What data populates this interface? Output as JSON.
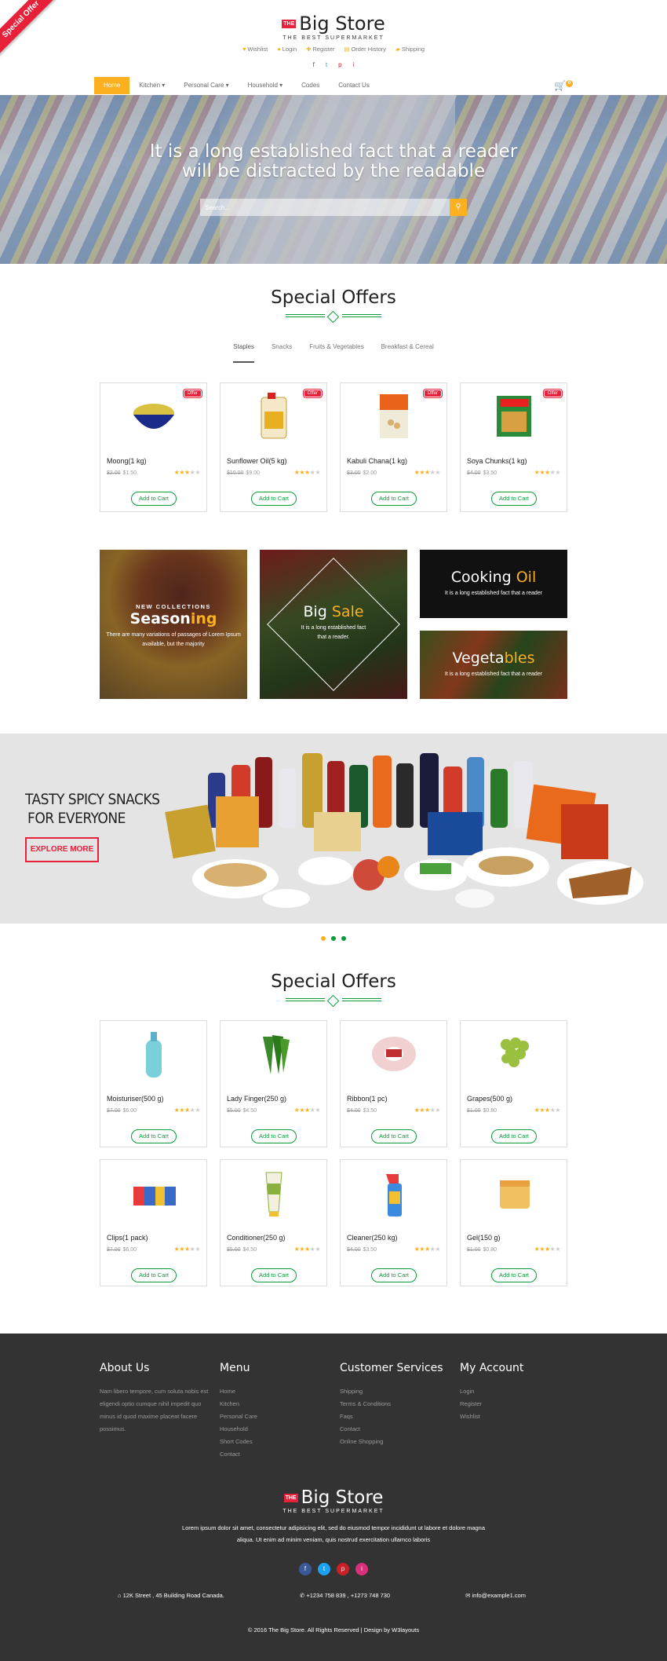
{
  "ribbon": "Special Offer",
  "brand": {
    "the": "THE",
    "name": "Big Store",
    "tagline": "THE BEST SUPERMARKET"
  },
  "toplinks": [
    "Wishlist",
    "Login",
    "Register",
    "Order History",
    "Shipping"
  ],
  "social": [
    "f",
    "t",
    "p",
    "i"
  ],
  "nav": [
    {
      "label": "Home",
      "active": true
    },
    {
      "label": "Kitchen ▾"
    },
    {
      "label": "Personal Care ▾"
    },
    {
      "label": "Household ▾"
    },
    {
      "label": "Codes"
    },
    {
      "label": "Contact Us"
    }
  ],
  "cart_count": "0",
  "hero": {
    "title_line1": "It is a long established fact that a reader",
    "title_line2": "will be distracted by the readable",
    "search_placeholder": "Search..."
  },
  "special1": {
    "title": "Special Offers",
    "tabs": [
      "Staples",
      "Snacks",
      "Fruits & Vegetables",
      "Breakfast & Cereal"
    ],
    "products": [
      {
        "name": "Moong(1 kg)",
        "old": "$2.00",
        "price": "$1.50",
        "rating": 3,
        "badge": "Offer",
        "img": "bowl-of-lentils"
      },
      {
        "name": "Sunflower Oil(5 kg)",
        "old": "$10.00",
        "price": "$9.00",
        "rating": 3,
        "badge": "Offer",
        "img": "oil-can"
      },
      {
        "name": "Kabuli Chana(1 kg)",
        "old": "$3.00",
        "price": "$2.00",
        "rating": 3,
        "badge": "Offer",
        "img": "chickpea-pack"
      },
      {
        "name": "Soya Chunks(1 kg)",
        "old": "$4.00",
        "price": "$3.50",
        "rating": 3,
        "badge": "Offer",
        "img": "nutrela-box"
      }
    ]
  },
  "add_label": "Add to Cart",
  "promos": {
    "seasoning": {
      "kicker": "NEW COLLECTIONS",
      "title_a": "Season",
      "title_b": "ing",
      "text": "There are many variations of passages of Lorem Ipsum available, but the majority"
    },
    "bigsale": {
      "title_a": "Big ",
      "title_b": "Sale",
      "text": "It is a long established fact that a reader."
    },
    "cooking": {
      "title_a": "Cooking ",
      "title_b": "Oil",
      "text": "It is a long established fact that a reader"
    },
    "veg": {
      "title_a": "Vegeta",
      "title_b": "bles",
      "text": "It is a long established fact that a reader"
    }
  },
  "banner": {
    "line1": "TASTY SPICY SNACKS",
    "line2": "FOR EVERYONE",
    "button": "EXPLORE MORE"
  },
  "special2": {
    "title": "Special Offers",
    "products": [
      {
        "name": "Moisturiser(500 g)",
        "old": "$7.00",
        "price": "$6.00",
        "rating": 3,
        "img": "lotion-bottle"
      },
      {
        "name": "Lady Finger(250 g)",
        "old": "$5.00",
        "price": "$4.50",
        "rating": 3,
        "img": "okra"
      },
      {
        "name": "Ribbon(1 pc)",
        "old": "$4.00",
        "price": "$3.50",
        "rating": 3,
        "img": "ribbon-roll"
      },
      {
        "name": "Grapes(500 g)",
        "old": "$1.00",
        "price": "$0.80",
        "rating": 3,
        "img": "grapes"
      },
      {
        "name": "Clips(1 pack)",
        "old": "$7.00",
        "price": "$6.00",
        "rating": 3,
        "img": "clips"
      },
      {
        "name": "Conditioner(250 g)",
        "old": "$5.00",
        "price": "$4.50",
        "rating": 3,
        "img": "tube"
      },
      {
        "name": "Cleaner(250 kg)",
        "old": "$4.00",
        "price": "$3.50",
        "rating": 3,
        "img": "spray-bottle"
      },
      {
        "name": "Gel(150 g)",
        "old": "$1.00",
        "price": "$0.80",
        "rating": 3,
        "img": "gel-jar"
      }
    ]
  },
  "footer": {
    "about": {
      "title": "About Us",
      "text": "Nam libero tempore, cum soluta nobis est eligendi optio cumque nihil impedit quo minus id quod maxime placeat facere possimus."
    },
    "menu": {
      "title": "Menu",
      "items": [
        "Home",
        "Kitchen",
        "Personal Care",
        "Household",
        "Short Codes",
        "Contact"
      ]
    },
    "services": {
      "title": "Customer Services",
      "items": [
        "Shipping",
        "Terms & Conditions",
        "Faqs",
        "Contact",
        "Online Shopping"
      ]
    },
    "account": {
      "title": "My Account",
      "items": [
        "Login",
        "Register",
        "Wishlist"
      ]
    },
    "desc_line1": "Lorem ipsum dolor sit amet, consectetur adipisicing elit, sed do eiusmod tempor incididunt ut labore et dolore magna",
    "desc_line2": "aliqua. Ut enim ad minim veniam, quis nostrud exercitation ullamco laboris",
    "address": "12K Street , 45 Building Road Canada.",
    "phone": "+1234 758 839 , +1273 748 730",
    "email": "info@example1.com",
    "copyright": "© 2016 The Big Store. All Rights Reserved | Design by W3layouts"
  },
  "colors": {
    "accent": "#fab01f",
    "green": "#0a9b3b",
    "red": "#e8213a",
    "footer": "#333333"
  }
}
